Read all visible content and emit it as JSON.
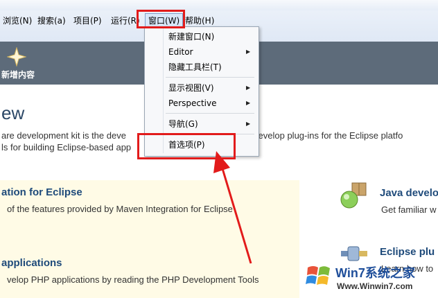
{
  "menubar": {
    "items": [
      {
        "label": "浏览(N)"
      },
      {
        "label": "搜索(a)"
      },
      {
        "label": "项目(P)"
      },
      {
        "label": "运行(R)"
      },
      {
        "label": "窗口(W)"
      },
      {
        "label": "帮助(H)"
      }
    ]
  },
  "window_menu": {
    "items": [
      {
        "label": "新建窗口(N)",
        "submenu": false
      },
      {
        "label": "Editor",
        "submenu": true
      },
      {
        "label": "隐藏工具栏(T)",
        "submenu": false
      },
      {
        "label": "显示视图(V)",
        "submenu": true
      },
      {
        "label": "Perspective",
        "submenu": true
      },
      {
        "label": "导航(G)",
        "submenu": true
      },
      {
        "label": "首选项(P)",
        "submenu": false
      }
    ]
  },
  "welcome": {
    "band_label": "新增内容",
    "title": "ew",
    "line1": "are development kit is the deve",
    "line1_right": "d to develop plug-ins for the Eclipse platfo",
    "line2": "ls for building Eclipse-based app"
  },
  "sections": {
    "maven": {
      "title": "ation for Eclipse",
      "desc": "of the features provided by Maven Integration for Eclipse"
    },
    "php": {
      "title": "applications",
      "desc": "velop PHP applications by reading the PHP Development Tools"
    },
    "java": {
      "title": "Java develo",
      "desc": "Get familiar w"
    },
    "plugin": {
      "title": "Eclipse plu",
      "desc": "Learn how to"
    }
  },
  "watermark": {
    "brand": "Win7系统之家",
    "url": "Www.Winwin7.com"
  },
  "colors": {
    "highlight": "#e21b1b",
    "link": "#1e4a7a",
    "band": "#5d6b7a"
  }
}
